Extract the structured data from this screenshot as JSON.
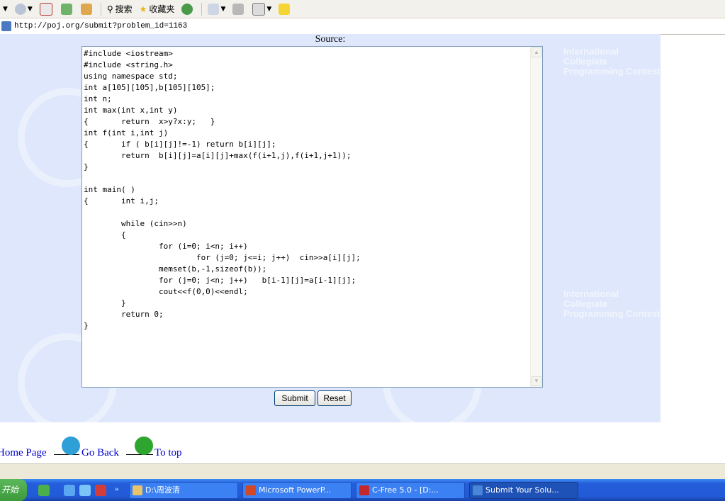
{
  "toolbar": {
    "search_label": "搜索",
    "favorites_label": "收藏夹"
  },
  "address": {
    "url": "http://poj.org/submit?problem_id=1163"
  },
  "page": {
    "source_label": "Source:"
  },
  "watermark": {
    "lines": [
      "International Collegiate",
      "Programming Contest"
    ]
  },
  "code_lines": [
    "#include <iostream>",
    "#include <string.h>",
    "using namespace std;",
    "int a[105][105],b[105][105];",
    "int n;",
    "int max(int x,int y)",
    "{       return  x>y?x:y;   }",
    "int f(int i,int j)",
    "{       if ( b[i][j]!=-1) return b[i][j];",
    "        return  b[i][j]=a[i][j]+max(f(i+1,j),f(i+1,j+1));",
    "}",
    "",
    "int main( )",
    "{       int i,j;",
    "",
    "        while (cin>>n)",
    "        {",
    "                for (i=0; i<n; i++)",
    "                        for (j=0; j<=i; j++)  cin>>a[i][j];",
    "                memset(b,-1,sizeof(b));",
    "                for (j=0; j<n; j++)   b[i-1][j]=a[i-1][j];",
    "                cout<<f(0,0)<<endl;",
    "        }",
    "        return 0;",
    "}"
  ],
  "buttons": {
    "submit": "Submit",
    "reset": "Reset"
  },
  "links": {
    "home": "Home Page",
    "back": "Go Back",
    "top": "To top"
  },
  "taskbar": {
    "start": "开始",
    "tasks": [
      {
        "label": "D:\\周波清",
        "color": "#e8c36a"
      },
      {
        "label": "Microsoft PowerP...",
        "color": "#d24726"
      },
      {
        "label": "C-Free 5.0 - [D:...",
        "color": "#c4282d"
      },
      {
        "label": "Submit Your Solu...",
        "color": "#4a86d8"
      }
    ]
  },
  "colors": {
    "panel": "#dee7fb",
    "link": "#0000cc"
  }
}
